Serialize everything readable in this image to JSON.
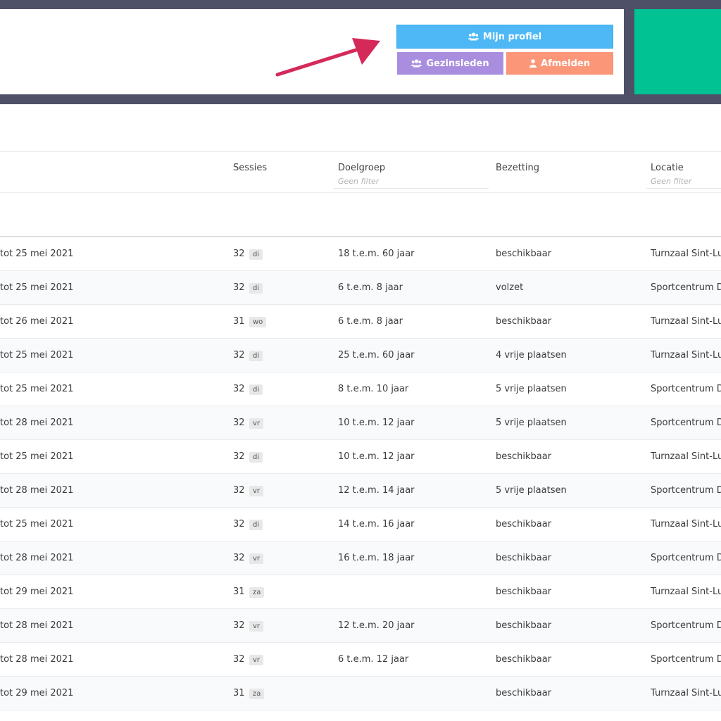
{
  "header": {
    "buttons": {
      "profile": "Mijn profiel",
      "family": "Gezinsleden",
      "logout": "Afmelden"
    }
  },
  "table": {
    "columns": {
      "sessies": "Sessies",
      "doelgroep": "Doelgroep",
      "doelgroep_filter": "Geen filter",
      "bezetting": "Bezetting",
      "locatie": "Locatie",
      "locatie_filter": "Geen filter"
    },
    "rows": [
      {
        "date": "tot 25 mei 2021",
        "sessions": "32",
        "day": "di",
        "doelgroep": "18 t.e.m. 60 jaar",
        "bezetting": "beschikbaar",
        "locatie": "Turnzaal Sint-Lu"
      },
      {
        "date": "tot 25 mei 2021",
        "sessions": "32",
        "day": "di",
        "doelgroep": "6 t.e.m. 8 jaar",
        "bezetting": "volzet",
        "locatie": "Sportcentrum D"
      },
      {
        "date": "tot 26 mei 2021",
        "sessions": "31",
        "day": "wo",
        "doelgroep": "6 t.e.m. 8 jaar",
        "bezetting": "beschikbaar",
        "locatie": "Turnzaal Sint-Lu"
      },
      {
        "date": "tot 25 mei 2021",
        "sessions": "32",
        "day": "di",
        "doelgroep": "25 t.e.m. 60 jaar",
        "bezetting": "4 vrije plaatsen",
        "locatie": "Turnzaal Sint-Lu"
      },
      {
        "date": "tot 25 mei 2021",
        "sessions": "32",
        "day": "di",
        "doelgroep": "8 t.e.m. 10 jaar",
        "bezetting": "5 vrije plaatsen",
        "locatie": "Sportcentrum D"
      },
      {
        "date": "tot 28 mei 2021",
        "sessions": "32",
        "day": "vr",
        "doelgroep": "10 t.e.m. 12 jaar",
        "bezetting": "5 vrije plaatsen",
        "locatie": "Sportcentrum D"
      },
      {
        "date": "tot 25 mei 2021",
        "sessions": "32",
        "day": "di",
        "doelgroep": "10 t.e.m. 12 jaar",
        "bezetting": "beschikbaar",
        "locatie": "Turnzaal Sint-Lu"
      },
      {
        "date": "tot 28 mei 2021",
        "sessions": "32",
        "day": "vr",
        "doelgroep": "12 t.e.m. 14 jaar",
        "bezetting": "5 vrije plaatsen",
        "locatie": "Sportcentrum D"
      },
      {
        "date": "tot 25 mei 2021",
        "sessions": "32",
        "day": "di",
        "doelgroep": "14 t.e.m. 16 jaar",
        "bezetting": "beschikbaar",
        "locatie": "Turnzaal Sint-Lu"
      },
      {
        "date": "tot 28 mei 2021",
        "sessions": "32",
        "day": "vr",
        "doelgroep": "16 t.e.m. 18 jaar",
        "bezetting": "beschikbaar",
        "locatie": "Sportcentrum D"
      },
      {
        "date": "tot 29 mei 2021",
        "sessions": "31",
        "day": "za",
        "doelgroep": "",
        "bezetting": "beschikbaar",
        "locatie": "Turnzaal Sint-Lu"
      },
      {
        "date": "tot 28 mei 2021",
        "sessions": "32",
        "day": "vr",
        "doelgroep": "12 t.e.m. 20 jaar",
        "bezetting": "beschikbaar",
        "locatie": "Sportcentrum D"
      },
      {
        "date": "tot 28 mei 2021",
        "sessions": "32",
        "day": "vr",
        "doelgroep": "6 t.e.m. 12 jaar",
        "bezetting": "beschikbaar",
        "locatie": "Sportcentrum D"
      },
      {
        "date": "tot 29 mei 2021",
        "sessions": "31",
        "day": "za",
        "doelgroep": "",
        "bezetting": "beschikbaar",
        "locatie": "Turnzaal Sint-Lu"
      }
    ]
  }
}
